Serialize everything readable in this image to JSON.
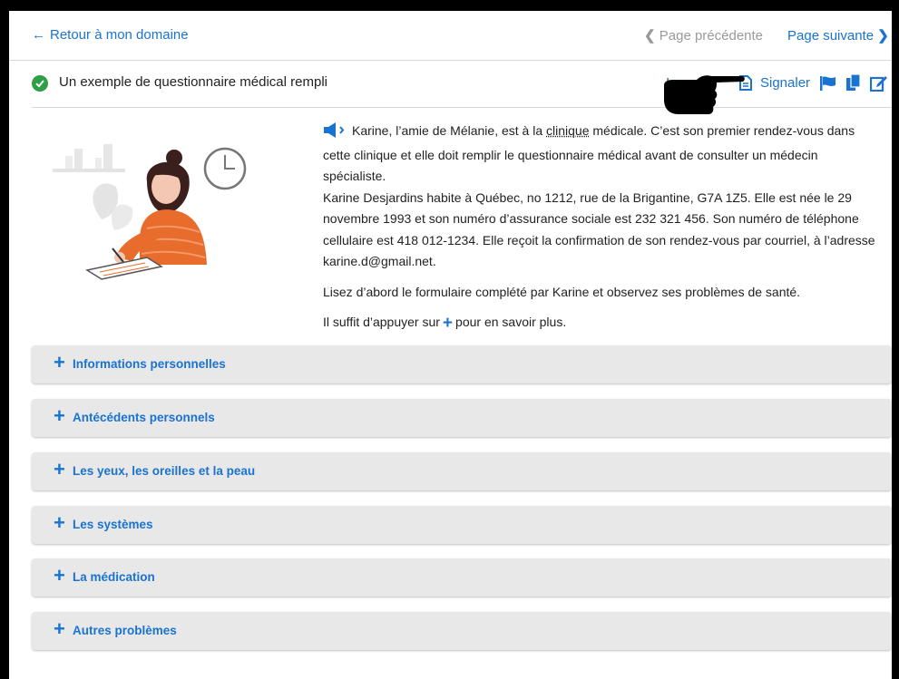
{
  "nav": {
    "back_label": "Retour à mon domaine",
    "prev_label": "Page précédente",
    "next_label": "Page suivante"
  },
  "header": {
    "title": "Un exemple de questionnaire médical rempli",
    "partial_link": "I",
    "signal_label": "Signaler"
  },
  "intro": {
    "p1_start": "Karine, l’amie de Mélanie, est à la ",
    "p1_word": "clinique",
    "p1_end": " médicale. C’est son premier rendez-vous dans cette clinique et elle doit remplir le questionnaire médical avant de consulter un médecin spécialiste.",
    "p1_details": "Karine Desjardins habite à Québec, no 1212, rue de la Brigantine, G7A 1Z5. Elle est née le 29 novembre 1993 et son numéro d’assurance sociale est 232 321 456. Son numéro de téléphone cellulaire est 418 012-1234. Elle reçoit la confirmation de son rendez-vous par courriel, à l’adresse karine.d@gmail.net.",
    "p2": "Lisez d’abord le formulaire complété par Karine et observez ses problèmes de santé.",
    "p3_start": "Il suffit d’appuyer sur",
    "p3_end": "pour en savoir plus."
  },
  "sections": [
    {
      "label": "Informations personnelles"
    },
    {
      "label": "Antécédents personnels"
    },
    {
      "label": "Les yeux, les oreilles et la peau"
    },
    {
      "label": "Les systèmes"
    },
    {
      "label": "La médication"
    },
    {
      "label": "Autres problèmes"
    }
  ],
  "colors": {
    "accent": "#1a73d1",
    "success": "#2e9e47",
    "accordion_bg": "#e8e8e8",
    "muted": "#9a9a9a"
  },
  "icons": [
    "arrow-left-icon",
    "chevron-left-icon",
    "chevron-right-icon",
    "check-circle-icon",
    "document-icon",
    "flag-icon",
    "copy-icon",
    "edit-icon",
    "pointing-hand-icon",
    "speaker-icon",
    "plus-icon"
  ]
}
